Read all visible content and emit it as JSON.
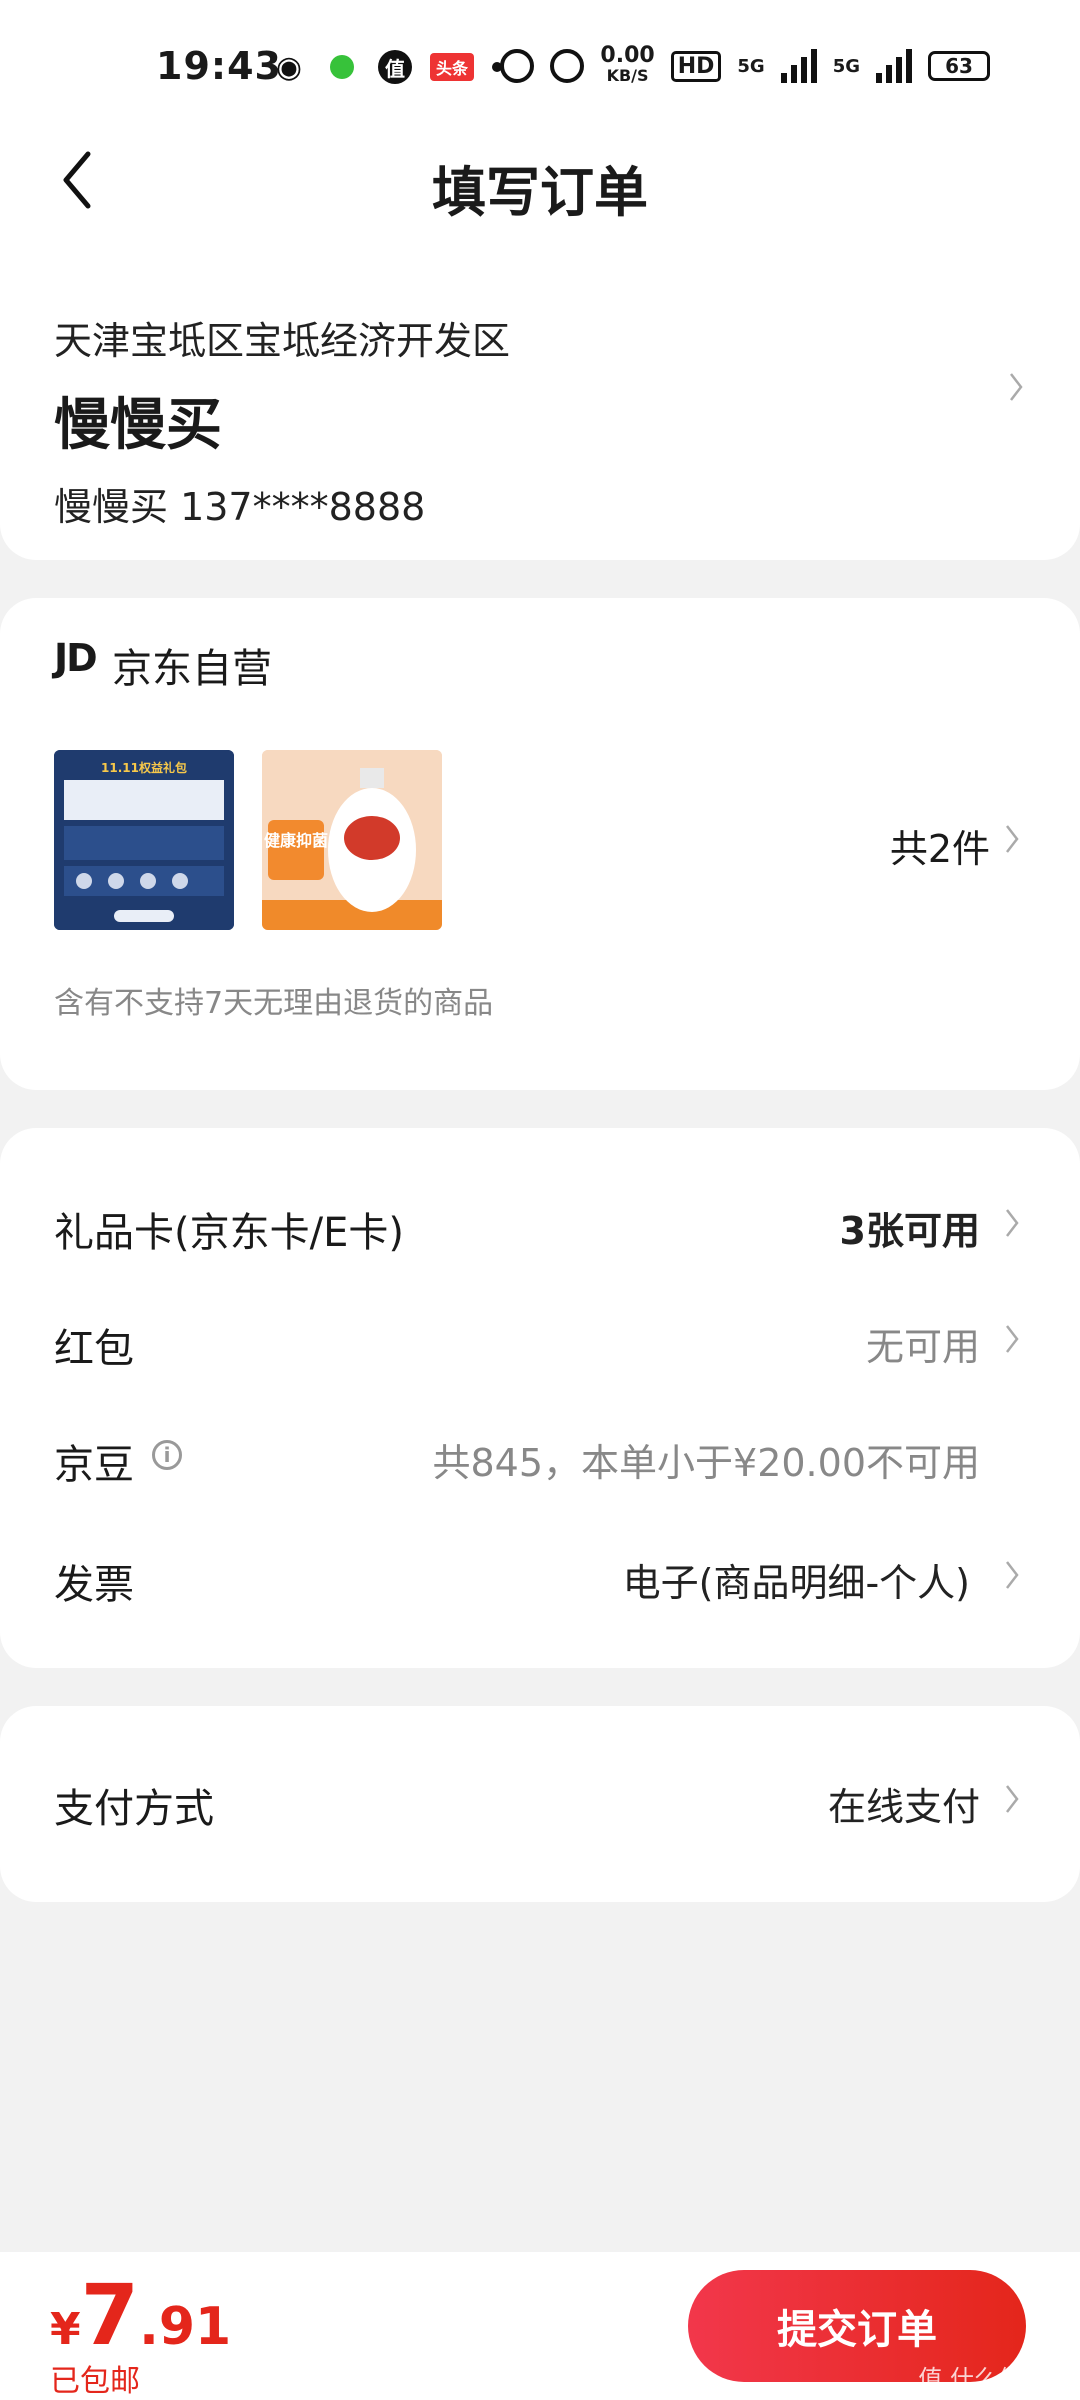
{
  "status_bar": {
    "time": "19:43",
    "icons": [
      "weibo-icon",
      "green-dot-icon",
      "zhi-icon",
      "toutiao-icon",
      "dot-icon"
    ],
    "toutiao_label": "头条",
    "zhi_label": "值",
    "net_speed": "0.00",
    "net_speed_unit": "KB/S",
    "hd_label": "HD",
    "signal1_label": "5G",
    "signal2_label": "5G",
    "battery": "63"
  },
  "navbar": {
    "title": "填写订单"
  },
  "address": {
    "region": "天津宝坻区宝坻经济开发区",
    "name": "慢慢买",
    "contact": "慢慢买  137****8888"
  },
  "shop": {
    "logo": "JD",
    "name": "京东自营",
    "item_count": "共2件",
    "return_note": "含有不支持7天无理由退货的商品",
    "thumb1_text": "11.11权益礼包",
    "thumb2_text": "健康抑菌"
  },
  "options": [
    {
      "label": "礼品卡(京东卡/E卡)",
      "value": "3张可用"
    },
    {
      "label": "红包",
      "value": "无可用"
    },
    {
      "label": "京豆",
      "value": "共845，本单小于¥20.00不可用"
    },
    {
      "label": "发票",
      "value": "电子(商品明细-个人)"
    }
  ],
  "payment": {
    "label": "支付方式",
    "value": "在线支付"
  },
  "footer": {
    "currency": "¥",
    "price_int": "7",
    "price_dec": ".91",
    "shipping": "已包邮",
    "submit_label": "提交订单",
    "watermark": "值 什么值得买"
  },
  "colors": {
    "accent": "#e4261b",
    "background": "#f2f2f2"
  }
}
